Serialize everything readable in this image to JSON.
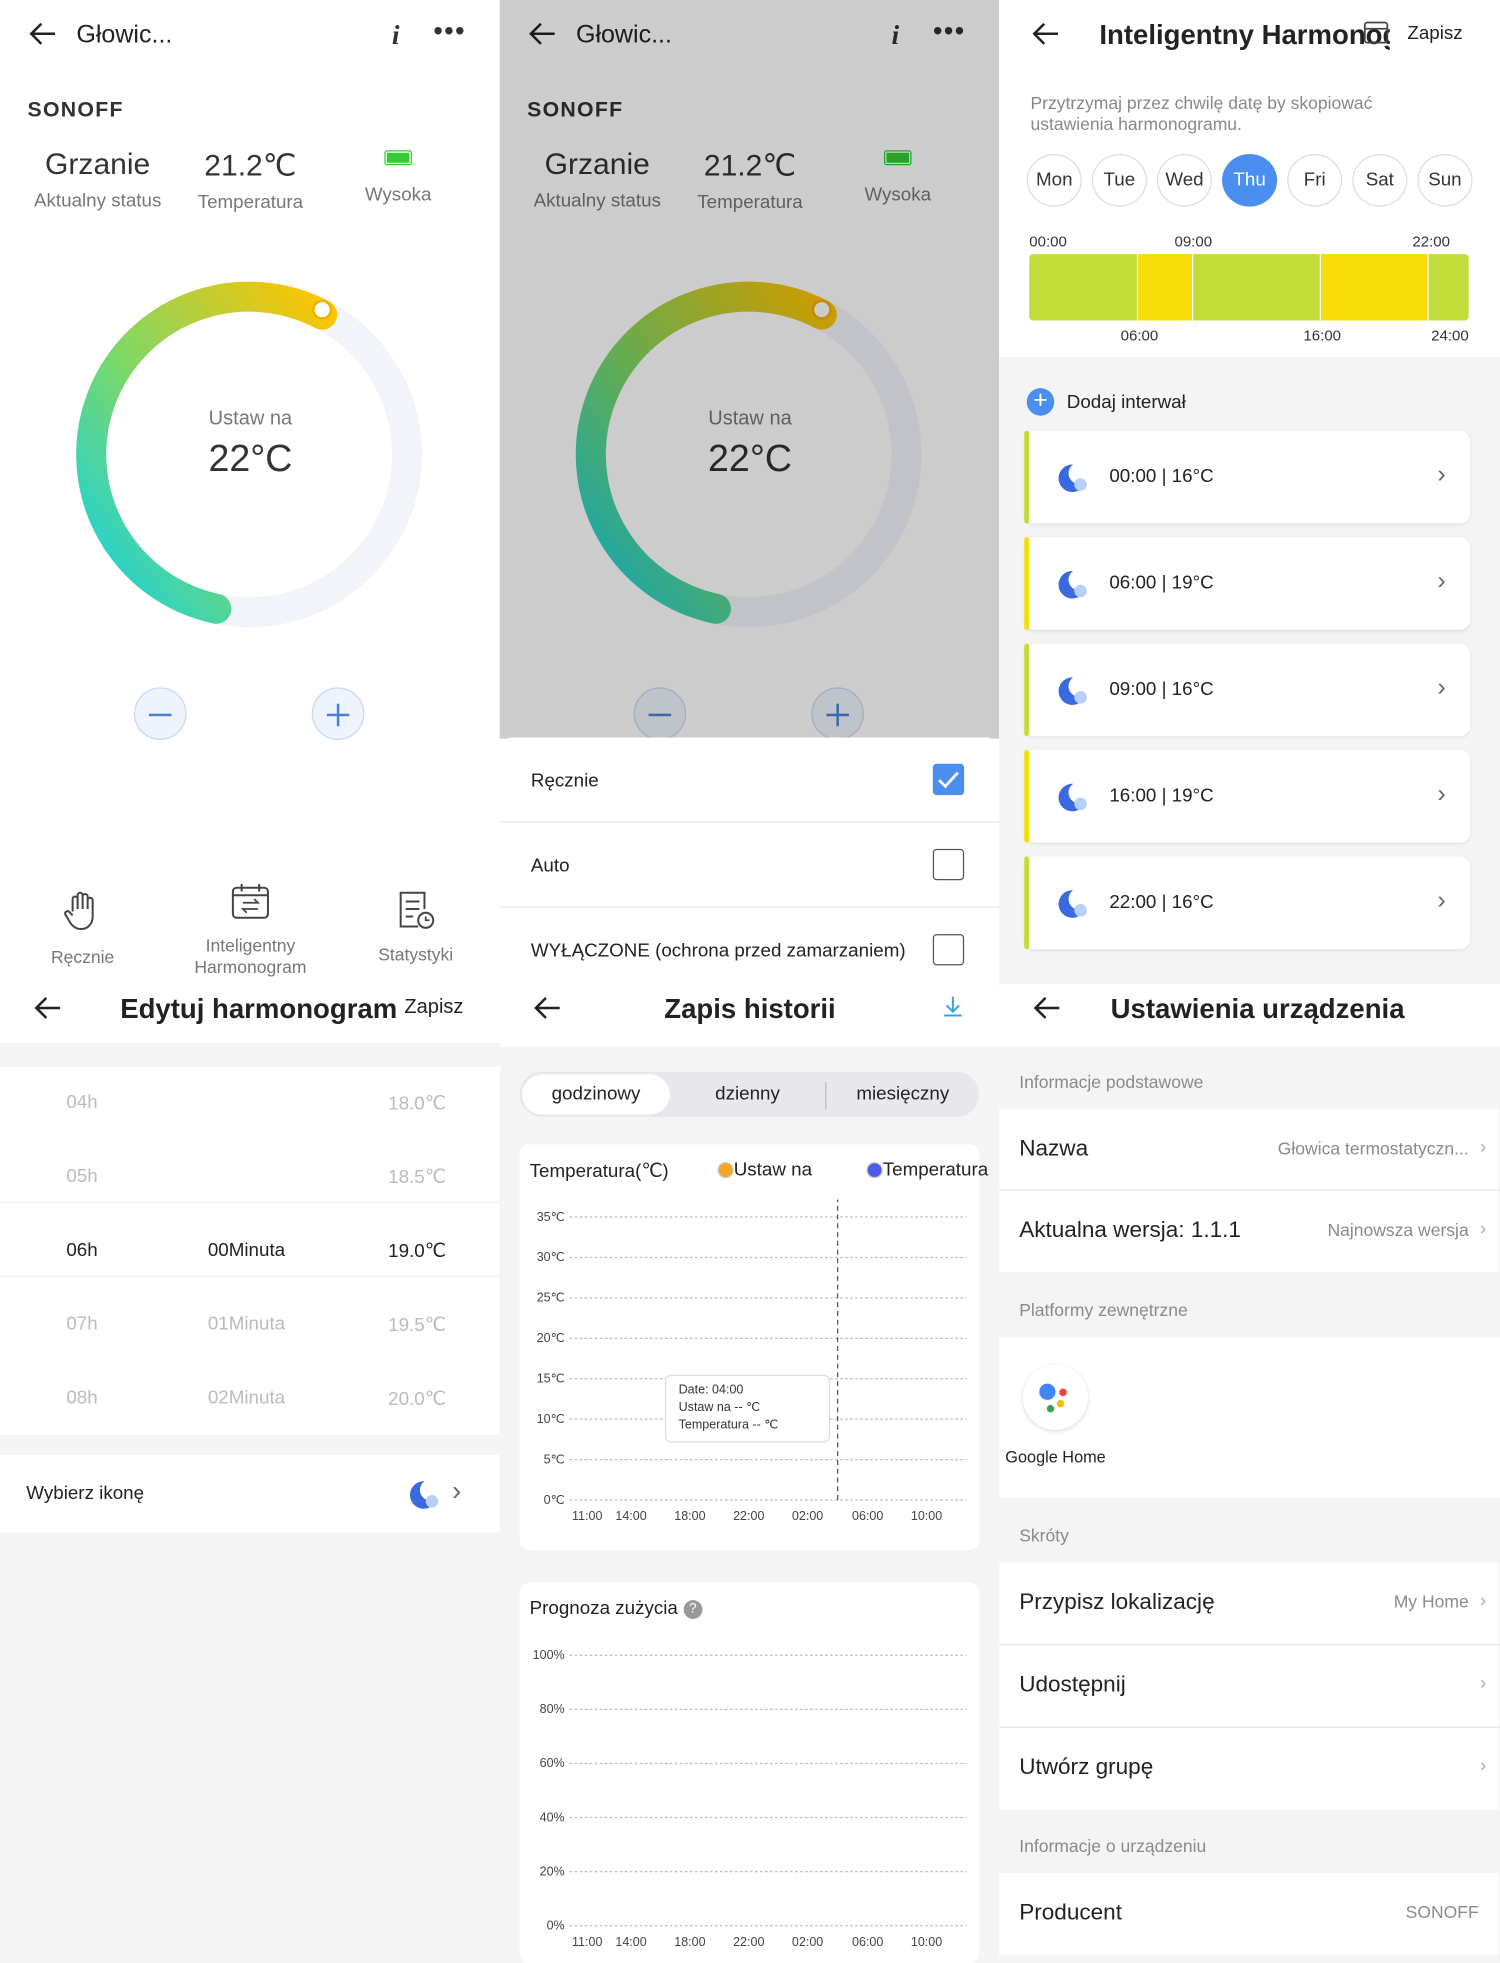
{
  "panel1": {
    "title": "Głowic...",
    "logo": "SONOFF",
    "status_value": "Grzanie",
    "status_label": "Aktualny status",
    "temp_value": "21.2℃",
    "temp_label": "Temperatura",
    "battery_label": "Wysoka",
    "set_label": "Ustaw na",
    "set_value": "22°C",
    "ring_fraction": 0.68,
    "bottom": {
      "manual": "Ręcznie",
      "smart_line1": "Inteligentny",
      "smart_line2": "Harmonogram",
      "stats": "Statystyki"
    }
  },
  "panel2": {
    "title": "Głowic...",
    "logo": "SONOFF",
    "status_value": "Grzanie",
    "status_label": "Aktualny status",
    "temp_value": "21.2℃",
    "temp_label": "Temperatura",
    "battery_label": "Wysoka",
    "set_label": "Ustaw na",
    "set_value": "22°C",
    "modes": [
      {
        "label": "Ręcznie",
        "checked": true
      },
      {
        "label": "Auto",
        "checked": false
      },
      {
        "label": "WYŁĄCZONE (ochrona przed zamarzaniem)",
        "checked": false
      }
    ]
  },
  "panel3": {
    "title": "Inteligentny Harmonog...",
    "save": "Zapisz",
    "hint": "Przytrzymaj przez chwilę datę by skopiować ustawienia harmonogramu.",
    "days": [
      "Mon",
      "Tue",
      "Wed",
      "Thu",
      "Fri",
      "Sat",
      "Sun"
    ],
    "selected_day": "Thu",
    "timeline_top": [
      "00:00",
      "09:00",
      "22:00"
    ],
    "timeline_bottom": [
      "06:00",
      "16:00",
      "24:00"
    ],
    "add_interval": "Dodaj interwał",
    "intervals": [
      {
        "label": "00:00 | 16°C",
        "color": "#c2dc3a"
      },
      {
        "label": "06:00 | 19°C",
        "color": "#f5dc0a"
      },
      {
        "label": "09:00 | 16°C",
        "color": "#c2dc3a"
      },
      {
        "label": "16:00 | 19°C",
        "color": "#f5dc0a"
      },
      {
        "label": "22:00 | 16°C",
        "color": "#c2dc3a"
      }
    ]
  },
  "panel4": {
    "title": "Edytuj harmonogram",
    "save": "Zapisz",
    "picker": [
      {
        "h": "04h",
        "m": "",
        "t": "18.0℃"
      },
      {
        "h": "05h",
        "m": "",
        "t": "18.5℃"
      },
      {
        "h": "06h",
        "m": "00Minuta",
        "t": "19.0℃"
      },
      {
        "h": "07h",
        "m": "01Minuta",
        "t": "19.5℃"
      },
      {
        "h": "08h",
        "m": "02Minuta",
        "t": "20.0℃"
      }
    ],
    "icon_label": "Wybierz ikonę"
  },
  "panel5": {
    "title": "Zapis historii",
    "tabs": [
      "godzinowy",
      "dzienny",
      "miesięczny"
    ],
    "chart1_title": "Temperatura(℃)",
    "legend": [
      "Ustaw na",
      "Temperatura"
    ],
    "tooltip": [
      "Date: 04:00",
      "Ustaw na -- ℃",
      "Temperatura -- ℃"
    ],
    "chart2_title": "Prognoza zużycia"
  },
  "chart_data": [
    {
      "type": "line",
      "title": "Temperatura(℃)",
      "series": [
        {
          "name": "Ustaw na",
          "values": []
        },
        {
          "name": "Temperatura",
          "values": []
        }
      ],
      "colors": [
        "#f5a623",
        "#4a5ce8"
      ],
      "yticks": [
        "35℃",
        "30℃",
        "25℃",
        "20℃",
        "15℃",
        "10℃",
        "5℃",
        "0℃"
      ],
      "xticks": [
        "11:00",
        "14:00",
        "18:00",
        "22:00",
        "02:00",
        "06:00",
        "10:00"
      ],
      "ylim": [
        0,
        35
      ],
      "grid": true
    },
    {
      "type": "line",
      "title": "Prognoza zużycia",
      "series": [],
      "yticks": [
        "100%",
        "80%",
        "60%",
        "40%",
        "20%",
        "0%"
      ],
      "xticks": [
        "11:00",
        "14:00",
        "18:00",
        "22:00",
        "02:00",
        "06:00",
        "10:00"
      ],
      "ylim": [
        0,
        100
      ],
      "grid": true
    }
  ],
  "panel6": {
    "title": "Ustawienia urządzenia",
    "sec_basic": "Informacje podstawowe",
    "name_label": "Nazwa",
    "name_value": "Głowica termostatyczn...",
    "ver_label": "Aktualna wersja:  1.1.1",
    "ver_value": "Najnowsza wersja",
    "sec_ext": "Platformy zewnętrzne",
    "google": "Google Home",
    "sec_short": "Skróty",
    "loc_label": "Przypisz lokalizację",
    "loc_value": "My Home",
    "share_label": "Udostępnij",
    "group_label": "Utwórz grupę",
    "sec_info": "Informacje o urządzeniu",
    "prod_label": "Producent",
    "prod_value": "SONOFF"
  }
}
